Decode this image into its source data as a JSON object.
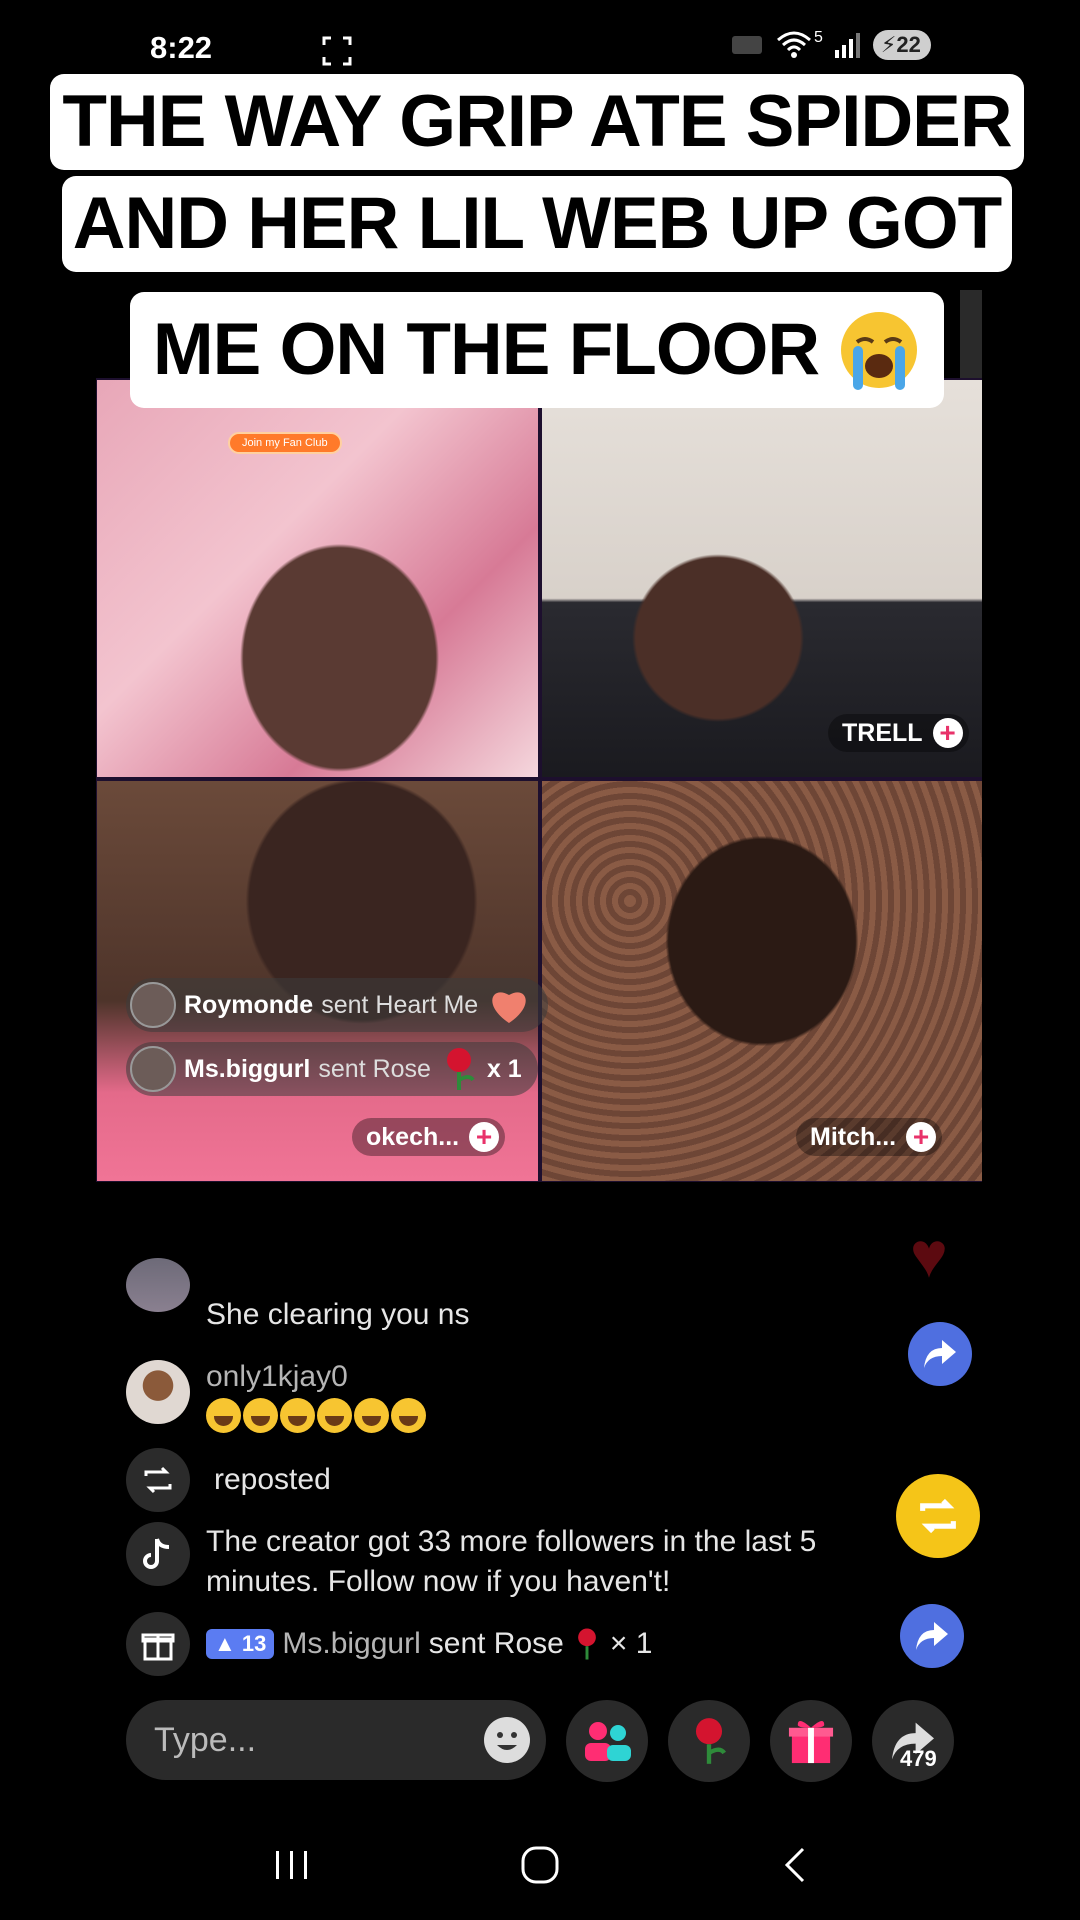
{
  "status_bar": {
    "time": "8:22",
    "network": "5",
    "battery": "22"
  },
  "caption": {
    "line1": "THE WAY GRIP ATE SPIDER",
    "line2": "AND HER LIL WEB UP GOT",
    "line3": "ME ON THE FLOOR"
  },
  "video_grid": {
    "fan_club_badge": "Join my Fan Club",
    "participants": [
      {
        "name": "TRELL"
      },
      {
        "name": "okech..."
      },
      {
        "name": "Mitch..."
      }
    ],
    "gift_overlays": [
      {
        "user": "Roymonde",
        "action": "sent Heart Me",
        "count": ""
      },
      {
        "user": "Ms.biggurl",
        "action": "sent Rose",
        "count": "x 1"
      }
    ]
  },
  "chat": {
    "messages": [
      {
        "user": "",
        "text": "She clearing you ns"
      },
      {
        "user": "only1kjay0",
        "text": ""
      },
      {
        "system": "repost",
        "text": "reposted"
      },
      {
        "system": "creator",
        "text": "The creator got 33 more followers in the last 5 minutes. Follow now if you haven't!"
      },
      {
        "system": "gift",
        "level": "13",
        "user": "Ms.biggurl",
        "text": "sent Rose",
        "count": "× 1"
      }
    ]
  },
  "input": {
    "placeholder": "Type..."
  },
  "actions": {
    "share_count": "479"
  },
  "colors": {
    "accent_pink": "#e8326a",
    "share_blue": "#4f6fe0",
    "repost_yellow": "#f5c518",
    "level_badge": "#5b7cf2"
  }
}
